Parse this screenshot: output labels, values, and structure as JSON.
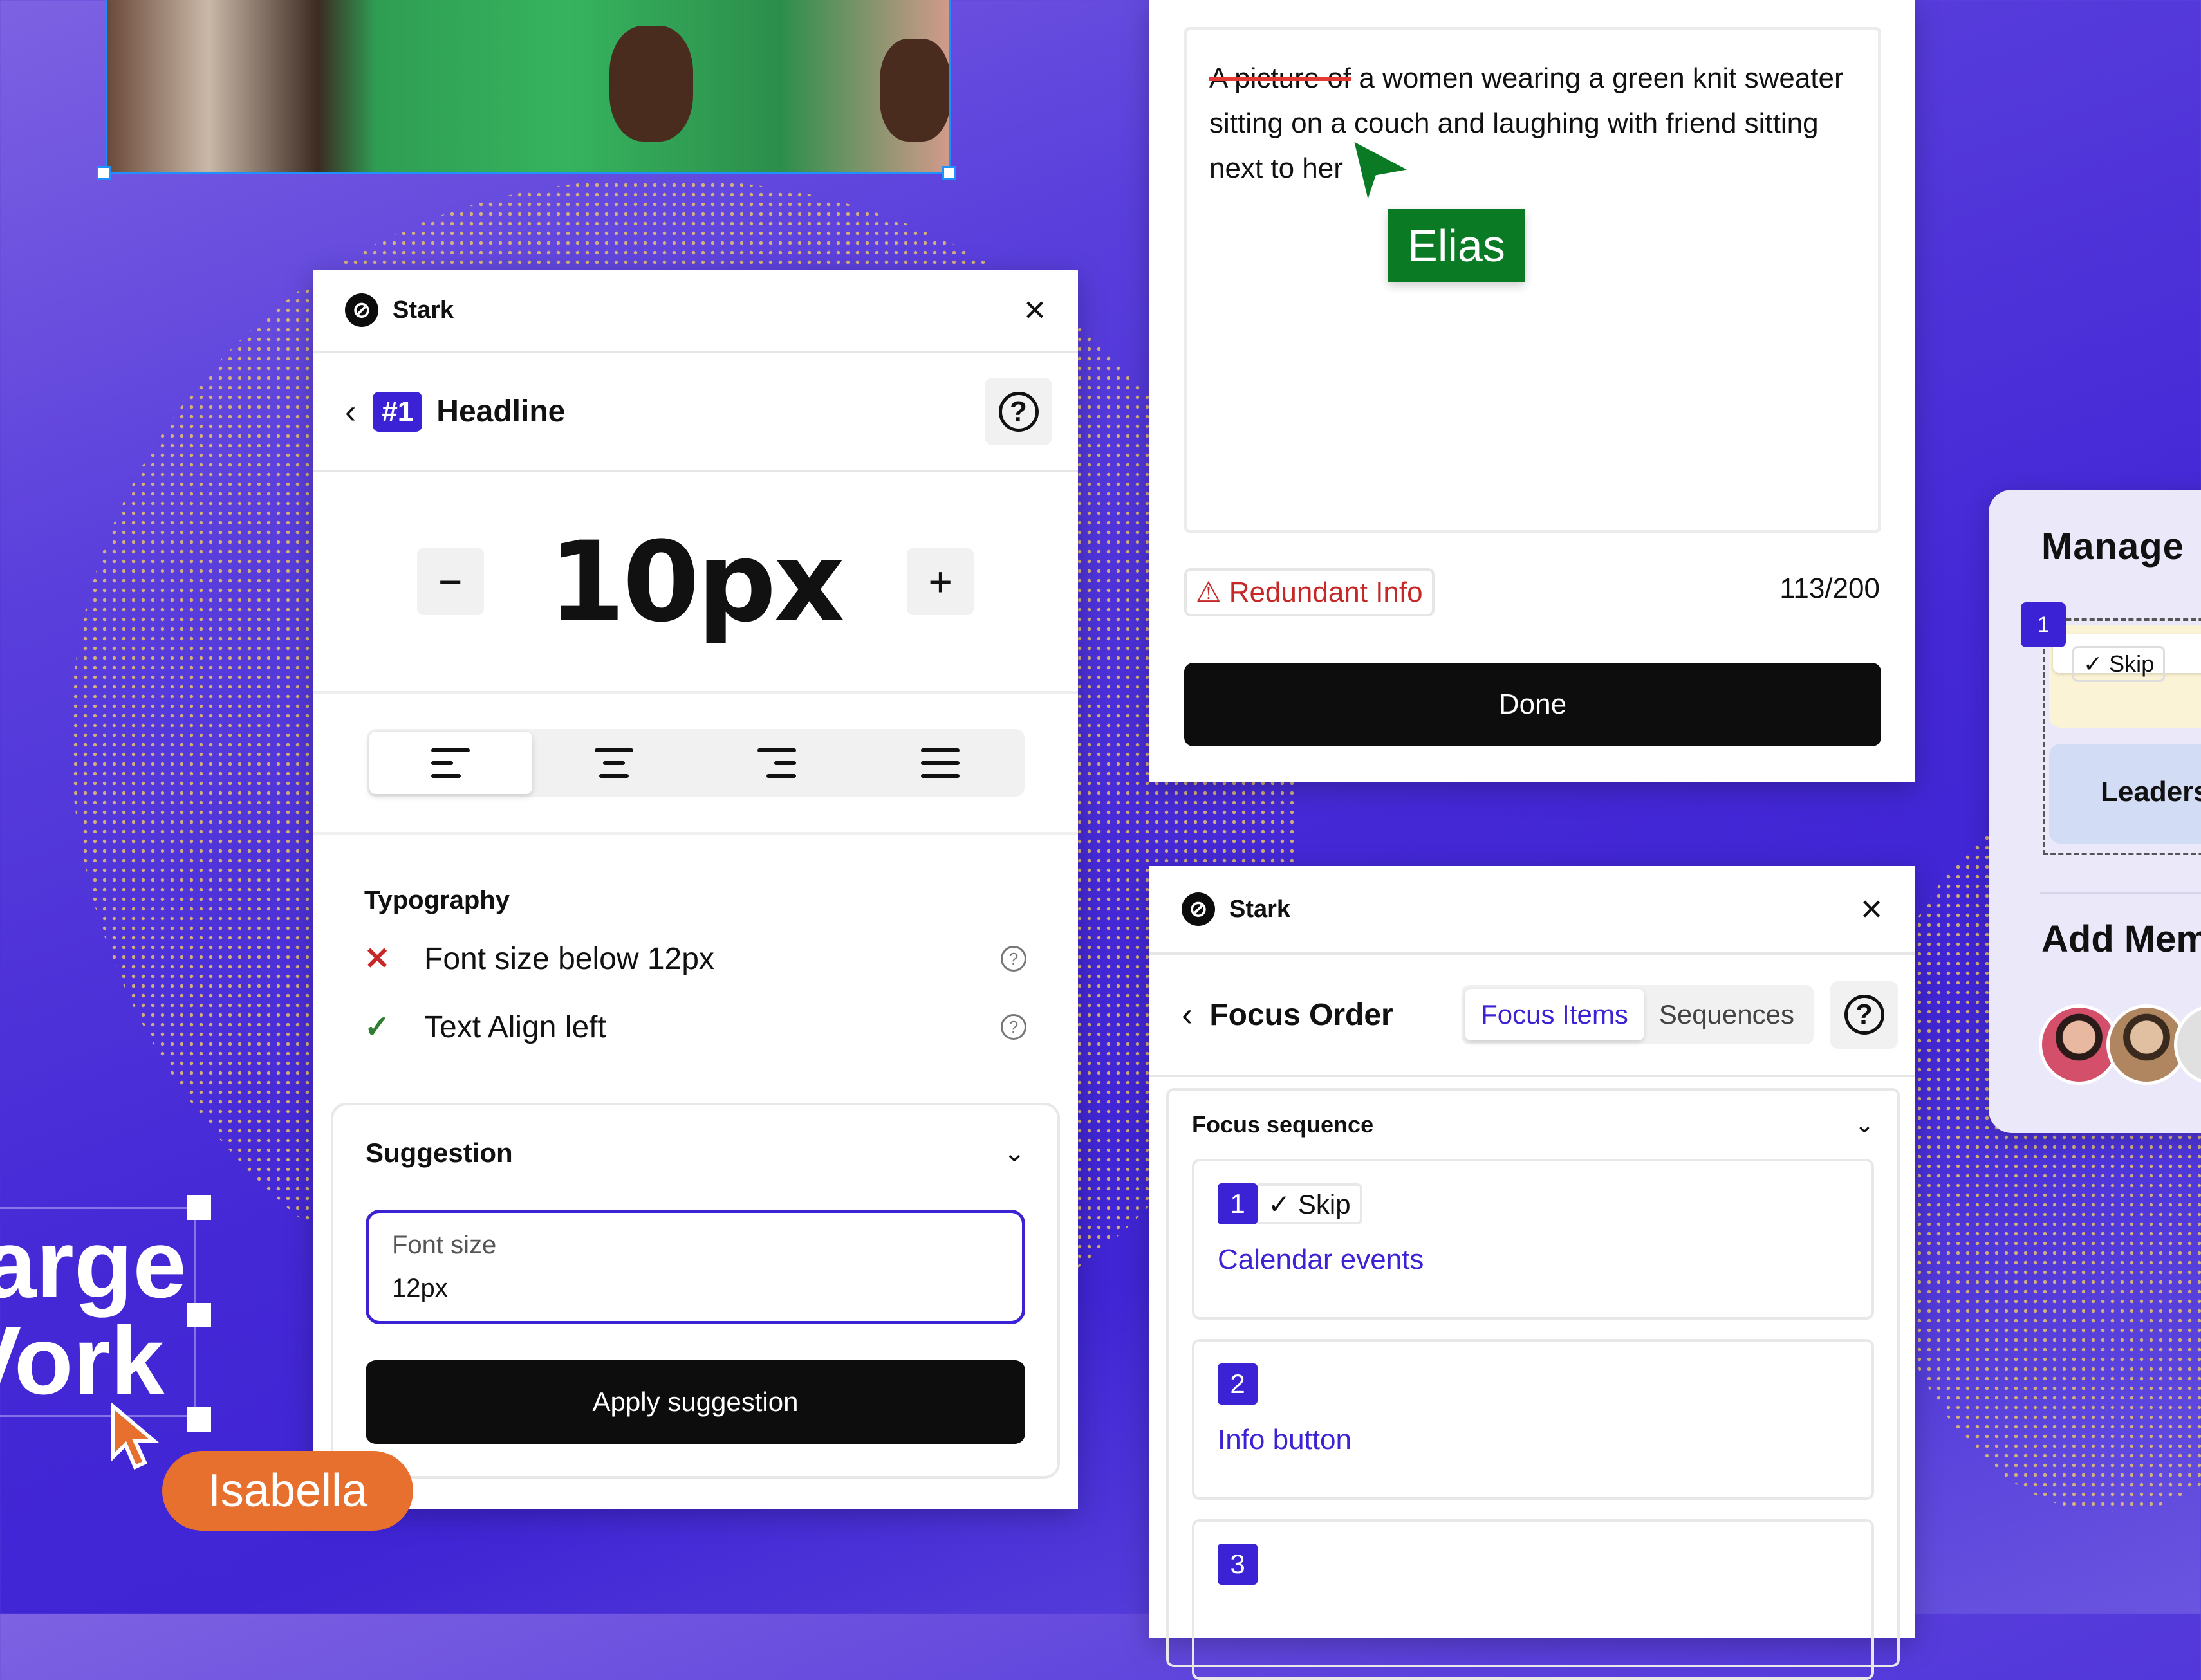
{
  "canvas": {
    "text_lines": [
      "arge",
      "Vork"
    ],
    "collaborators": [
      {
        "name": "Isabella",
        "color": "#e8702f"
      },
      {
        "name": "Elias",
        "color": "#0a7a24"
      }
    ]
  },
  "headline_panel": {
    "brand": "Stark",
    "logo_glyph": "⊘",
    "close_icon": "×",
    "back_icon": "‹",
    "badge": "#1",
    "title": "Headline",
    "help_icon": "?",
    "font_size_value": "10px",
    "decrement_label": "−",
    "increment_label": "+",
    "alignment_options": [
      {
        "name": "align-left",
        "active": true
      },
      {
        "name": "align-center",
        "active": false
      },
      {
        "name": "align-right",
        "active": false
      },
      {
        "name": "align-justify",
        "active": false
      }
    ],
    "typography_heading": "Typography",
    "checks": [
      {
        "status": "fail",
        "icon": "✕",
        "label": "Font size below 12px",
        "color": "#c62828"
      },
      {
        "status": "pass",
        "icon": "✓",
        "label": "Text Align left",
        "color": "#2e7d32"
      }
    ],
    "suggestion_heading": "Suggestion",
    "suggestion_field_label": "Font size",
    "suggestion_field_value": "12px",
    "apply_button": "Apply suggestion"
  },
  "alt_text_panel": {
    "struck_text": "A picture of",
    "text": " a women wearing a green knit sweater sitting on a couch and laughing with friend sitting next to her",
    "warning_label": "Redundant Info",
    "warning_icon": "⚠",
    "char_count": "113/200",
    "done_button": "Done"
  },
  "focus_order_panel": {
    "brand": "Stark",
    "logo_glyph": "⊘",
    "close_icon": "×",
    "back_icon": "‹",
    "title": "Focus Order",
    "tabs": [
      {
        "label": "Focus Items",
        "active": true
      },
      {
        "label": "Sequences",
        "active": false
      }
    ],
    "help_icon": "?",
    "section_heading": "Focus sequence",
    "items": [
      {
        "number": "1",
        "skip": "✓ Skip",
        "label": "Calendar events"
      },
      {
        "number": "2",
        "skip": "",
        "label": "Info button"
      },
      {
        "number": "3",
        "skip": "",
        "label": ""
      }
    ]
  },
  "manage_panel": {
    "title": "Manage",
    "badge": "1",
    "skip_label": "✓ Skip",
    "leaders_label": "Leaders",
    "add_members_title": "Add Mem"
  },
  "colors": {
    "accent": "#3b22d4",
    "background": "#3f25d4",
    "error": "#c62828",
    "success": "#2e7d32",
    "dots": "#e9c46a"
  }
}
